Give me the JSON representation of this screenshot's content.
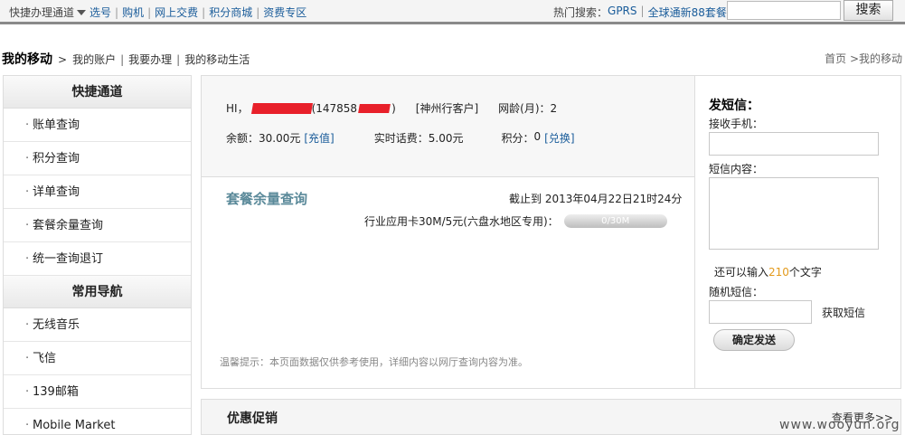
{
  "topbar": {
    "quick": "快捷办理通道",
    "links": [
      "选号",
      "购机",
      "网上交费",
      "积分商城",
      "资费专区"
    ],
    "hot_label": "热门搜索：",
    "hot_links": [
      "GPRS",
      "全球通新88套餐"
    ],
    "search_button": "搜索"
  },
  "crumb": {
    "main": "我的移动",
    "arrow": ">",
    "items": [
      "我的账户",
      "我要办理",
      "我的移动生活"
    ],
    "right": "首页 >我的移动"
  },
  "sidebar": {
    "section1": "快捷通道",
    "items1": [
      "账单查询",
      "积分查询",
      "详单查询",
      "套餐余量查询",
      "统一查询退订"
    ],
    "section2": "常用导航",
    "items2": [
      "无线音乐",
      "飞信",
      "139邮箱",
      "Mobile Market"
    ]
  },
  "info": {
    "hi": "HI，",
    "phone_prefix": "(147858",
    "phone_suffix": ")",
    "customer_type": "[神州行客户]",
    "age_label": "网龄(月)：",
    "age": "2",
    "balance_label": "余额：",
    "balance": "30.00元",
    "recharge": "[充值]",
    "realtime_label": "实时话费：",
    "realtime": "5.00元",
    "points_label": "积分：",
    "points": "0",
    "redeem": "[兑换]"
  },
  "package": {
    "title": "套餐余量查询",
    "date": "截止到 2013年04月22日21时24分",
    "item": "行业应用卡30M/5元(六盘水地区专用)：",
    "usage": "0/30M",
    "usage_fraction": 0
  },
  "tip": "温馨提示：本页面数据仅供参考使用，详细内容以网厅查询内容为准。",
  "sms": {
    "title": "发短信：",
    "phone_label": "接收手机：",
    "content_label": "短信内容：",
    "remain_prefix": "还可以输入",
    "remain_count": "210",
    "remain_suffix": "个文字",
    "random_label": "随机短信：",
    "get_sms": "获取短信",
    "send": "确定发送"
  },
  "promo": {
    "title": "优惠促销",
    "more": "查看更多>>"
  },
  "watermark": "www.wooyun.org"
}
